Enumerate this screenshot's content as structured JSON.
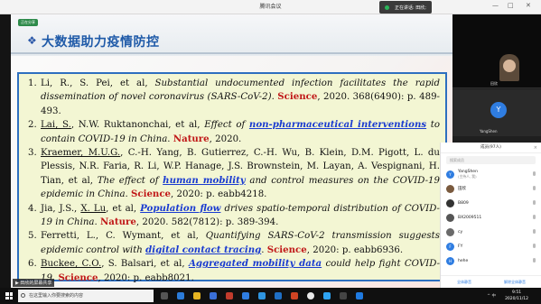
{
  "window": {
    "title": "腾讯会议",
    "share_status": "正在讲话: 田欣;",
    "min_btn": "—",
    "max_btn": "□",
    "close_btn": "✕"
  },
  "slide": {
    "badge": "正在分享",
    "title": "大数据助力疫情防控",
    "title_color": "#1f5aa8"
  },
  "references": [
    {
      "num": "1.",
      "parts": [
        {
          "t": "Li, R., S. Pei, et al, "
        },
        {
          "t": "Substantial undocumented infection facilitates the rapid dissemination of novel coronavirus (SARS-CoV-2)",
          "s": "it"
        },
        {
          "t": ". "
        },
        {
          "t": "Science",
          "s": "jr"
        },
        {
          "t": ", 2020. 368(6490): p. 489-493."
        }
      ]
    },
    {
      "num": "2.",
      "parts": [
        {
          "t": "Lai, S.",
          "s": "ul"
        },
        {
          "t": ", N.W. Ruktanonchai, et al, "
        },
        {
          "t": "Effect of ",
          "s": "it"
        },
        {
          "t": "non-pharmaceutical interventions",
          "s": "kw"
        },
        {
          "t": " to contain COVID-19 in China",
          "s": "it"
        },
        {
          "t": ". "
        },
        {
          "t": "Nature",
          "s": "jr"
        },
        {
          "t": ", 2020."
        }
      ]
    },
    {
      "num": "3.",
      "parts": [
        {
          "t": "Kraemer, M.U.G.",
          "s": "ul"
        },
        {
          "t": ", C.-H. Yang, B. Gutierrez, C.-H. Wu, B. Klein, D.M. Pigott, L. du Plessis, N.R. Faria, R. Li, W.P. Hanage, J.S. Brownstein, M. Layan, A. Vespignani, H. Tian, et al, "
        },
        {
          "t": "The effect of ",
          "s": "it"
        },
        {
          "t": "human mobility",
          "s": "kw"
        },
        {
          "t": " and control measures on the COVID-19 epidemic in China",
          "s": "it"
        },
        {
          "t": ". "
        },
        {
          "t": "Science",
          "s": "jr"
        },
        {
          "t": ", 2020: p. eabb4218."
        }
      ]
    },
    {
      "num": "4.",
      "parts": [
        {
          "t": "Jia, J.S., "
        },
        {
          "t": "X. Lu",
          "s": "ul"
        },
        {
          "t": ", et al, "
        },
        {
          "t": "Population flow",
          "s": "kw"
        },
        {
          "t": " drives spatio-temporal distribution of COVID-19 in China",
          "s": "it"
        },
        {
          "t": ". "
        },
        {
          "t": "Nature",
          "s": "jr"
        },
        {
          "t": ", 2020. 582(7812): p. 389-394."
        }
      ]
    },
    {
      "num": "5.",
      "parts": [
        {
          "t": "Ferretti, L., C. Wymant, et al, "
        },
        {
          "t": "Quantifying SARS-CoV-2 transmission suggests epidemic control with ",
          "s": "it"
        },
        {
          "t": "digital contact tracing",
          "s": "kw"
        },
        {
          "t": ". "
        },
        {
          "t": "Science",
          "s": "jr"
        },
        {
          "t": ", 2020: p. eabb6936."
        }
      ]
    },
    {
      "num": "6.",
      "parts": [
        {
          "t": "Buckee, C.O.",
          "s": "ul"
        },
        {
          "t": ", S. Balsari, et al, "
        },
        {
          "t": "Aggregated mobility data",
          "s": "kw"
        },
        {
          "t": " could help fight COVID-19",
          "s": "it"
        },
        {
          "t": ". "
        },
        {
          "t": "Science",
          "s": "jr"
        },
        {
          "t": ", 2020: p. eabb8021."
        }
      ]
    }
  ],
  "share_label": "▶ 田欣的屏幕共享",
  "video": {
    "cam1_name": "田欣",
    "cam2_avatar": "Y",
    "cam2_name": "YangShen"
  },
  "members_panel": {
    "header": "成员(97人)",
    "close": "×",
    "search_placeholder": "搜索成员",
    "members": [
      {
        "avatar": "Y",
        "name": "YangShen",
        "sub": "(主持人, 我)",
        "color": "#2f7de1"
      },
      {
        "avatar": "",
        "name": "田欣",
        "sub": "",
        "color": "#7a5a3e"
      },
      {
        "avatar": "",
        "name": "B809",
        "sub": "",
        "color": "#333333"
      },
      {
        "avatar": "",
        "name": "BX2009511",
        "sub": "",
        "color": "#555555"
      },
      {
        "avatar": "",
        "name": "cy",
        "sub": "",
        "color": "#6a6a6a"
      },
      {
        "avatar": "F",
        "name": "FY",
        "sub": "",
        "color": "#2f7de1"
      },
      {
        "avatar": "H",
        "name": "hehe",
        "sub": "",
        "color": "#2f7de1"
      }
    ],
    "mute_all": "全体静音",
    "unmute_all": "解除全体静音"
  },
  "taskbar": {
    "search_placeholder": "在这里输入你要搜索的内容",
    "time": "9:51",
    "date": "2020/11/12",
    "tray_text": "^ 中"
  }
}
